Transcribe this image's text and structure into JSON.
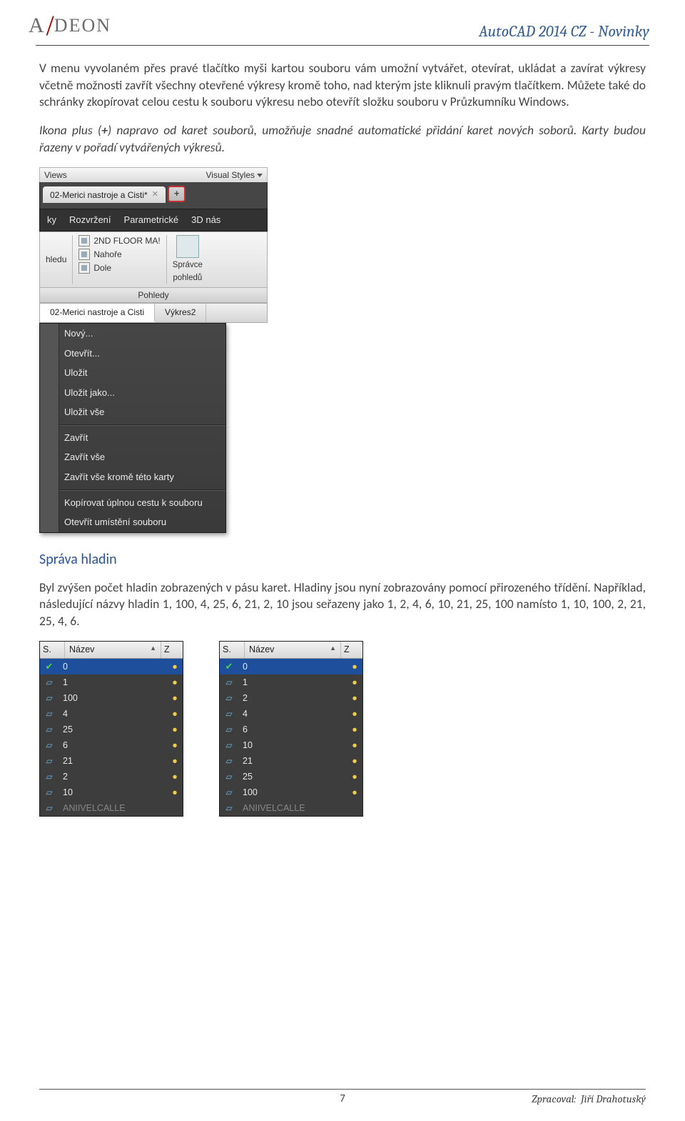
{
  "header": {
    "logo_text": "A DEON",
    "doc_title": "AutoCAD 2014 CZ - Novinky"
  },
  "body": {
    "p1": "V menu vyvolaném přes pravé tlačítko myši kartou souboru vám umožní vytvářet, otevírat, ukládat a zavírat výkresy včetně možnosti zavřít všechny otevřené výkresy kromě toho, nad kterým jste kliknuli pravým tlačítkem. Můžete také do schránky zkopírovat celou cestu k souboru výkresu nebo otevřít složku souboru v Průzkumníku Windows.",
    "p2_a": "Ikona plus (",
    "p2_b": "+",
    "p2_c": ") napravo od karet souborů, umožňuje snadné automatické přidání karet nových soborů. Karty budou řazeny v pořadí vytvářených výkresů.",
    "section": "Správa hladin",
    "p3": "Byl zvýšen počet hladin zobrazených v pásu karet. Hladiny jsou nyní zobrazovány pomocí přirozeného třídění. Například, následující názvy hladin 1, 100, 4, 25, 6, 21, 2, 10 jsou seřazeny jako 1, 2, 4, 6, 10, 21, 25, 100 namísto 1, 10, 100, 2, 21, 25, 4, 6."
  },
  "shot1": {
    "views_label": "Views",
    "visual_styles_label": "Visual Styles",
    "file_tab": "02-Merici nastroje a Cisti*",
    "plus": "+",
    "menu_top": {
      "a": "ky",
      "b": "Rozvržení",
      "c": "Parametrické",
      "d": "3D nás"
    },
    "ribbon": {
      "col1_label": "hledu",
      "col2_items": {
        "a": "2ND FLOOR MA!",
        "b": "Nahoře",
        "c": "Dole"
      },
      "col3": {
        "line1": "Správce",
        "line2": "pohledů"
      },
      "panel_label": "Pohledy"
    },
    "tabs2": {
      "a": "02-Merici nastroje a Cisti",
      "b": "Výkres2"
    },
    "ctx": {
      "novy": "Nový...",
      "otevrit": "Otevřít...",
      "ulozit": "Uložit",
      "ulozit_jako": "Uložit jako...",
      "ulozit_vse": "Uložit vše",
      "zavrit": "Zavřít",
      "zavrit_vse": "Zavřít vše",
      "zavrit_krome": "Zavřít vše kromě této karty",
      "kopirovat": "Kopírovat úplnou cestu k souboru",
      "otevrit_umisteni": "Otevřít umístění souboru"
    }
  },
  "layers": {
    "header": {
      "s": "S.",
      "name": "Název",
      "z": "Z"
    },
    "left": [
      "0",
      "1",
      "100",
      "4",
      "25",
      "6",
      "21",
      "2",
      "10"
    ],
    "right": [
      "0",
      "1",
      "2",
      "4",
      "6",
      "10",
      "21",
      "25",
      "100"
    ],
    "truncated": "ANIIVELCALLE"
  },
  "footer": {
    "page": "7",
    "author_label": "Zpracoval:",
    "author_name": "Jiří Drahotuský"
  }
}
